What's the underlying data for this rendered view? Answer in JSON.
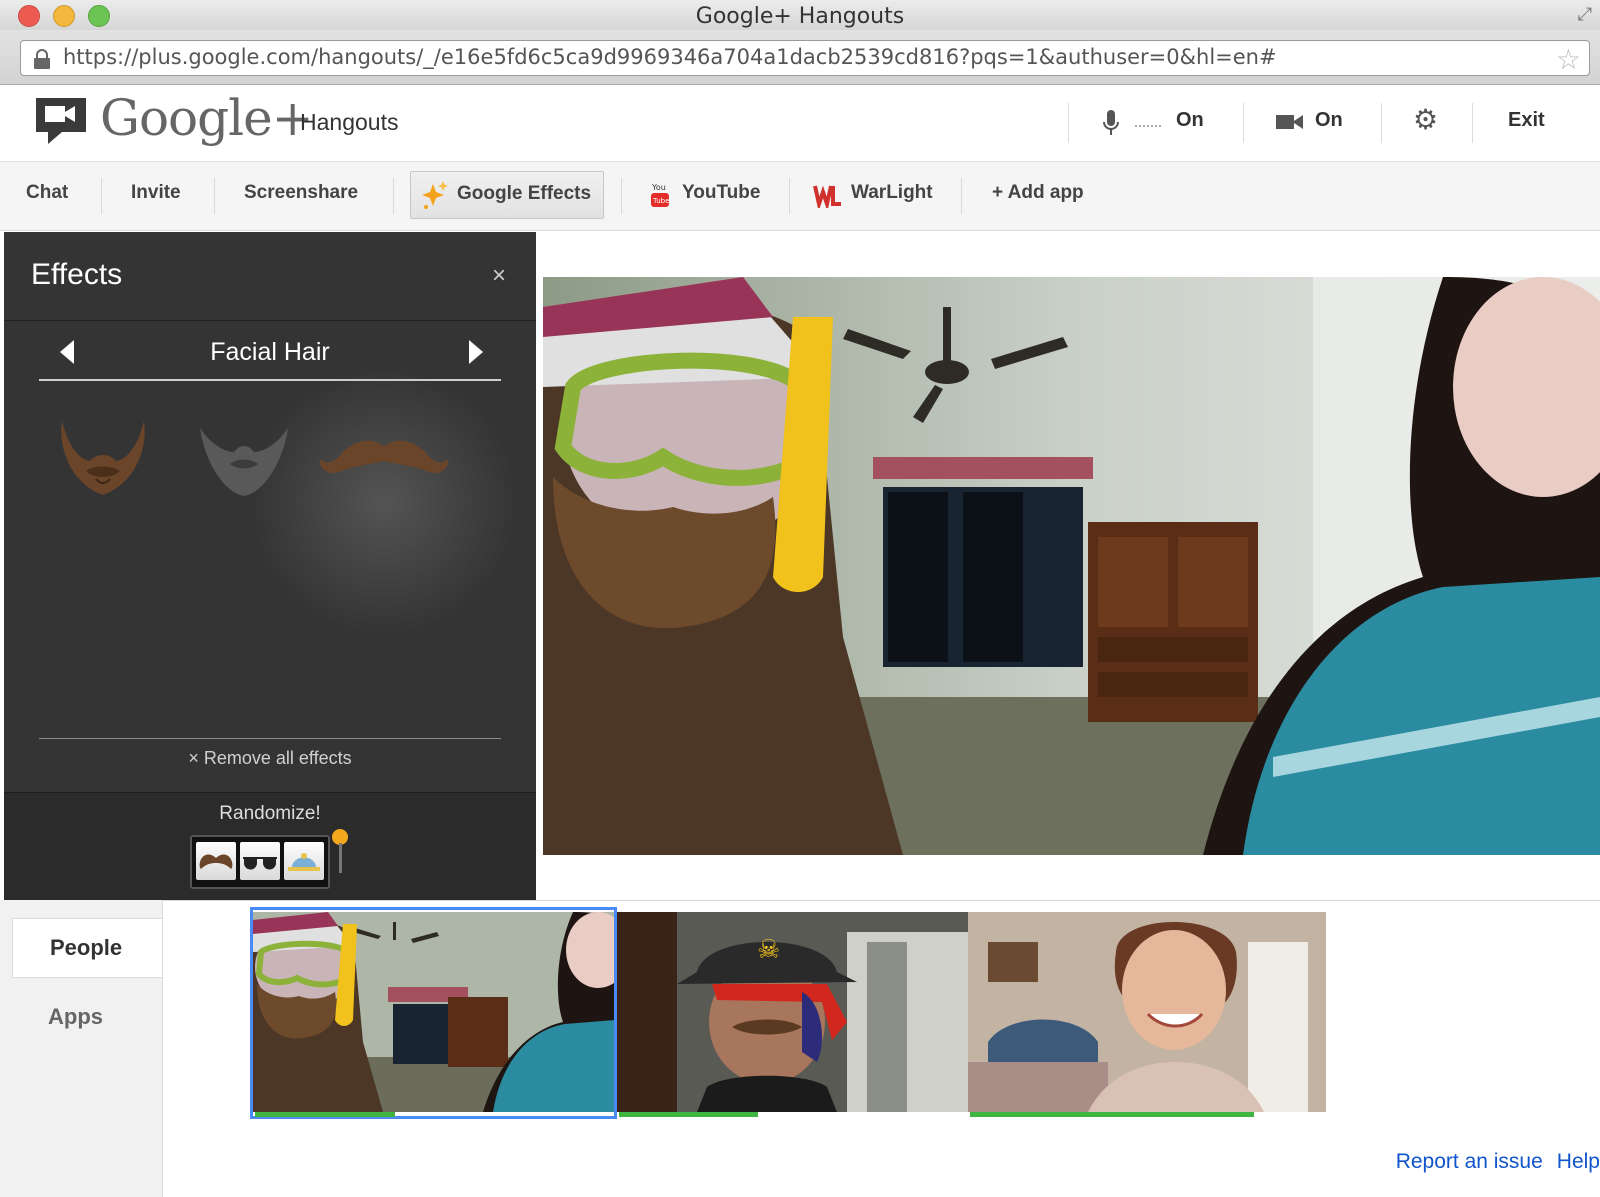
{
  "window": {
    "title": "Google+ Hangouts",
    "url": "https://plus.google.com/hangouts/_/e16e5fd6c5ca9d9969346a704a1dacb2539cd816?pqs=1&authuser=0&hl=en#"
  },
  "header": {
    "brand": "Google+",
    "product": "Hangouts",
    "mic_label": "On",
    "camera_label": "On",
    "exit_label": "Exit"
  },
  "toolbar": {
    "chat": "Chat",
    "invite": "Invite",
    "screenshare": "Screenshare",
    "google_effects": "Google Effects",
    "youtube": "YouTube",
    "warlight": "WarLight",
    "add_app": "+ Add app"
  },
  "effects_panel": {
    "title": "Effects",
    "close": "×",
    "category": "Facial Hair",
    "items": [
      "full-beard",
      "goatee-beard",
      "handlebar-mustache",
      "chevron-mustache"
    ],
    "selected_item": "handlebar-mustache",
    "remove_all": "× Remove all effects",
    "randomize": "Randomize!"
  },
  "sidebar": {
    "tabs": [
      {
        "label": "People",
        "active": true
      },
      {
        "label": "Apps",
        "active": false
      }
    ]
  },
  "participants": [
    {
      "name": "",
      "selected": true,
      "volume": 0.39
    },
    {
      "name": "",
      "selected": false,
      "volume": 0.4
    },
    {
      "name": "",
      "selected": false,
      "volume": 0.8
    }
  ],
  "footer": {
    "report": "Report an issue",
    "help": "Help"
  },
  "colors": {
    "selected_border": "#4a8af4",
    "volume_bar": "#3fb53f",
    "effects_bg": "#343434",
    "link": "#1155cc"
  }
}
